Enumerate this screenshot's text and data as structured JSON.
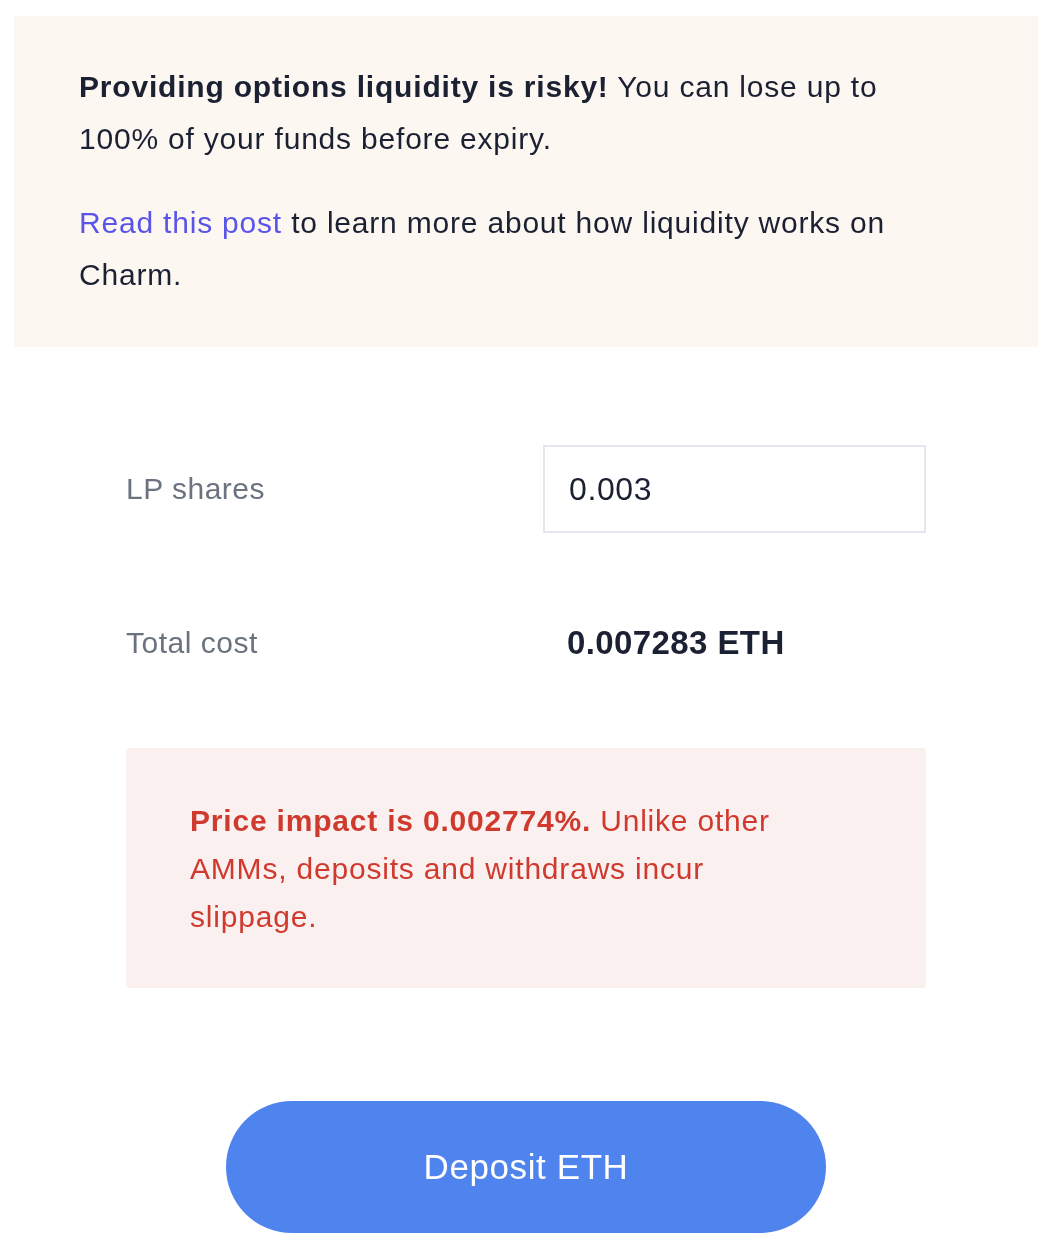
{
  "warning": {
    "paragraphs": [
      {
        "kind": "text",
        "text": "**Providing options liquidity is risky!** You can lose up to 100% of your funds before expiry."
      },
      {
        "kind": "link_text",
        "link": "Read this post",
        "text": "to learn more about how liquidity works on Charm."
      }
    ]
  },
  "fields": [
    {
      "kind": "input",
      "label": "LP shares",
      "value": "0.003"
    },
    {
      "kind": "readout",
      "label": "Total cost",
      "value": "0.007283 ETH"
    }
  ],
  "alert": {
    "text": "**Price impact is 0.002774%.** Unlike other AMMs, deposits and withdraws incur slippage."
  },
  "button": {
    "label": "Deposit ETH"
  }
}
